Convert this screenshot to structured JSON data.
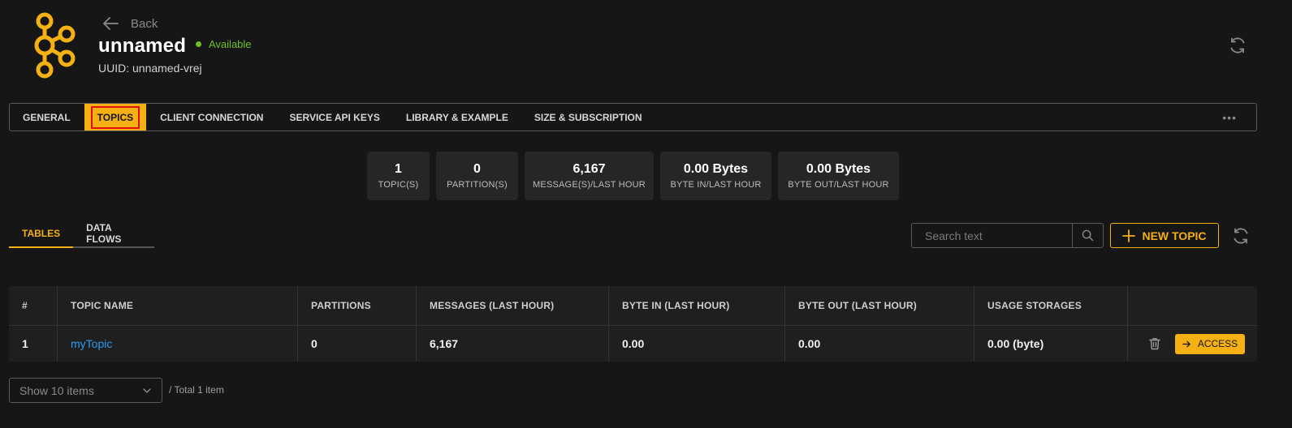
{
  "header": {
    "back_label": "Back",
    "title": "unnamed",
    "status": "Available",
    "uuid": "UUID: unnamed-vrej"
  },
  "main_tabs": [
    {
      "label": "GENERAL"
    },
    {
      "label": "TOPICS",
      "active": true
    },
    {
      "label": "CLIENT CONNECTION"
    },
    {
      "label": "SERVICE API KEYS"
    },
    {
      "label": "LIBRARY & EXAMPLE"
    },
    {
      "label": "SIZE & SUBSCRIPTION"
    }
  ],
  "more_label": "•••",
  "stats": [
    {
      "value": "1",
      "label": "TOPIC(S)"
    },
    {
      "value": "0",
      "label": "PARTITION(S)"
    },
    {
      "value": "6,167",
      "label": "MESSAGE(S)/LAST HOUR"
    },
    {
      "value": "0.00 Bytes",
      "label": "BYTE IN/LAST HOUR"
    },
    {
      "value": "0.00 Bytes",
      "label": "BYTE OUT/LAST HOUR"
    }
  ],
  "sub_tabs": [
    {
      "label": "TABLES",
      "active": true
    },
    {
      "label": "DATA FLOWS"
    }
  ],
  "search": {
    "placeholder": "Search text",
    "value": ""
  },
  "new_topic_label": "NEW TOPIC",
  "table": {
    "columns": [
      "#",
      "TOPIC NAME",
      "PARTITIONS",
      "MESSAGES (LAST HOUR)",
      "BYTE IN (LAST HOUR)",
      "BYTE OUT (LAST HOUR)",
      "USAGE STORAGES",
      ""
    ],
    "rows": [
      {
        "index": "1",
        "topic_name": "myTopic",
        "partitions": "0",
        "messages": "6,167",
        "byte_in": "0.00",
        "byte_out": "0.00",
        "usage": "0.00 (byte)",
        "access_label": "ACCESS"
      }
    ]
  },
  "pagination": {
    "page_size_label": "Show 10 items",
    "total": "/ Total 1 item"
  },
  "colors": {
    "accent": "#f5b014",
    "status_ok": "#6cc024",
    "link": "#2f9bf0",
    "highlight_border": "#e01010",
    "background": "#161616"
  },
  "icons": [
    "kafka-logo",
    "arrow-left-icon",
    "refresh-icon",
    "search-icon",
    "plus-icon",
    "trash-icon",
    "arrow-right-icon",
    "chevron-down-icon"
  ]
}
